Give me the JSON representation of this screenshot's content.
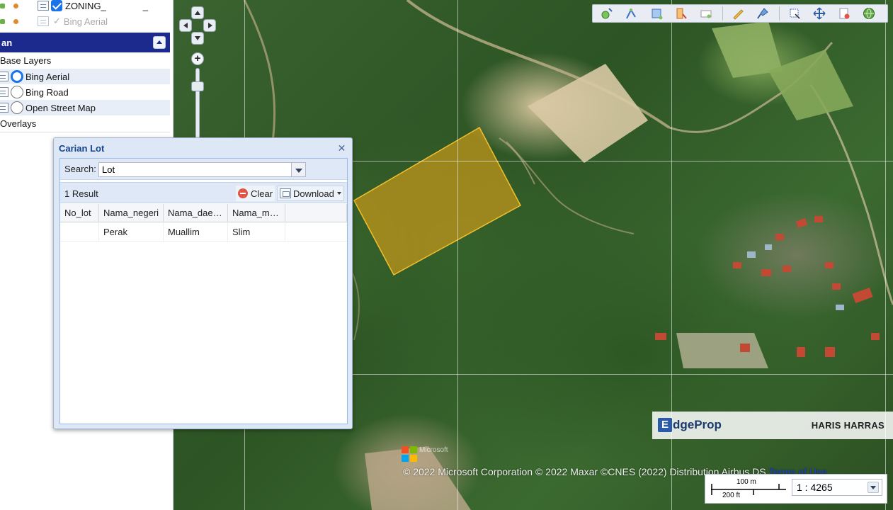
{
  "layers": {
    "zoning_label": "ZONING_",
    "zoning_suffix": "_",
    "bing_aerial_overlay_label": "Bing Aerial",
    "panel_title": "an",
    "base_layers_label": "Base Layers",
    "base_layers": [
      {
        "label": "Bing Aerial",
        "selected": true
      },
      {
        "label": "Bing Road",
        "selected": false
      },
      {
        "label": "Open Street Map",
        "selected": false
      }
    ],
    "overlays_label": "Overlays"
  },
  "toolbar": {
    "tools": [
      "add-point-icon",
      "edit-line-icon",
      "select-area-icon",
      "layer-edit-icon",
      "label-icon",
      "pencil-icon",
      "brush-icon",
      "select-icon",
      "move-icon",
      "clear-icon",
      "globe-icon"
    ]
  },
  "dialog": {
    "title": "Carian Lot",
    "search_label": "Search:",
    "search_value": "Lot",
    "result_text": "1 Result",
    "clear_label": "Clear",
    "download_label": "Download",
    "columns": [
      "No_lot",
      "Nama_negeri",
      "Nama_dae…",
      "Nama_m…",
      ""
    ],
    "rows": [
      [
        "",
        "Perak",
        "Muallim",
        "Slim",
        ""
      ]
    ]
  },
  "watermark": {
    "brand_e": "E",
    "brand_rest": "dgeProp",
    "agent": "HARIS HARRAS"
  },
  "attribution": {
    "ms_text": "Microsoft",
    "text": "© 2022 Microsoft Corporation © 2022 Maxar ©CNES (2022) Distribution Airbus DS",
    "terms": "Terms of Use"
  },
  "scale": {
    "metric": "100 m",
    "imperial": "200 ft",
    "ratio": "1 : 4265"
  },
  "colors": {
    "panel_header": "#1b2a8c",
    "selection_fill": "#e3a418",
    "accent": "#1a73e8"
  }
}
